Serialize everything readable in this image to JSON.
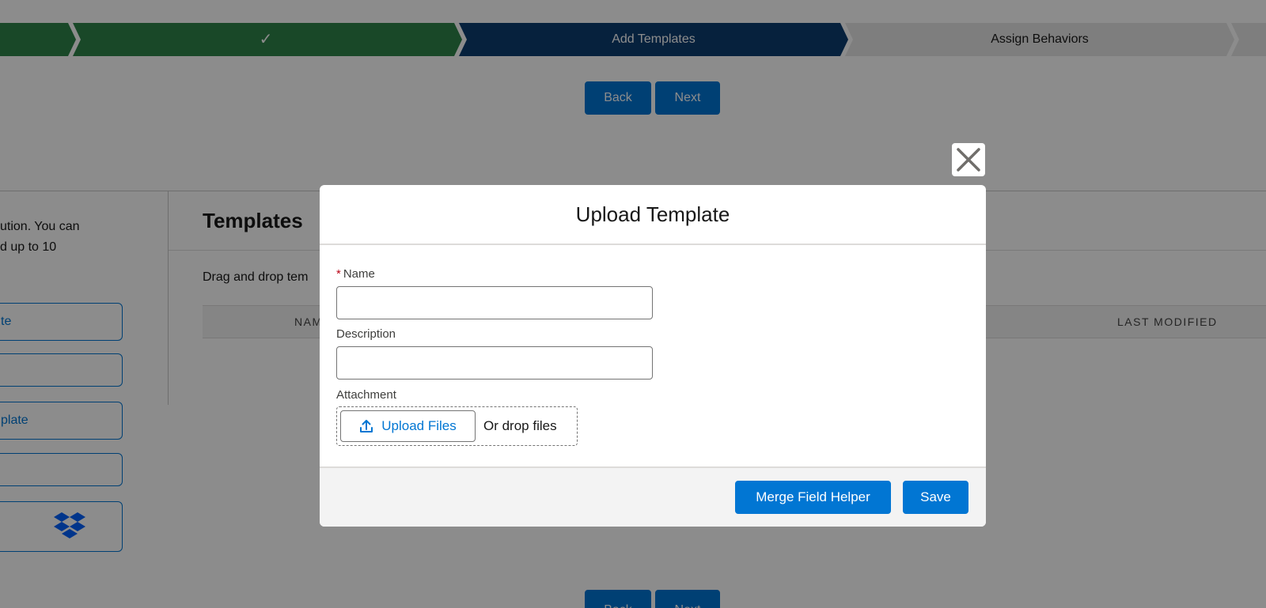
{
  "progress_path": {
    "steps": [
      {
        "label": "",
        "state": "complete"
      },
      {
        "label": "",
        "state": "complete",
        "icon": "check-icon"
      },
      {
        "label": "Add Templates",
        "state": "current"
      },
      {
        "label": "Assign Behaviors",
        "state": "incomplete"
      }
    ],
    "colors": {
      "complete": "#2e844a",
      "current": "#0b3d70",
      "incomplete": "#e5e5e5"
    }
  },
  "nav_top": {
    "back_label": "Back",
    "next_label": "Next"
  },
  "nav_bottom": {
    "back_label": "Back",
    "next_label": "Next"
  },
  "left_panel": {
    "text_line1": "ution. You can",
    "text_line2": "d up to 10",
    "buttons": [
      "te",
      "",
      "plate",
      ""
    ],
    "dropbox_icon": "dropbox-icon"
  },
  "templates_section": {
    "title": "Templates",
    "help_text": "Drag and drop tem",
    "columns": [
      "NAM",
      "LAST MODIFIED"
    ]
  },
  "modal": {
    "title": "Upload Template",
    "close_icon": "close-icon",
    "name_label": "Name",
    "required_marker": "*",
    "name_value": "",
    "description_label": "Description",
    "description_value": "",
    "attachment_label": "Attachment",
    "upload_button_label": "Upload Files",
    "upload_icon": "upload-icon",
    "drop_text": "Or drop files",
    "merge_field_helper_label": "Merge Field Helper",
    "save_label": "Save"
  },
  "colors": {
    "brand": "#0176d3",
    "overlay": "rgba(0,0,0,0.45)"
  }
}
